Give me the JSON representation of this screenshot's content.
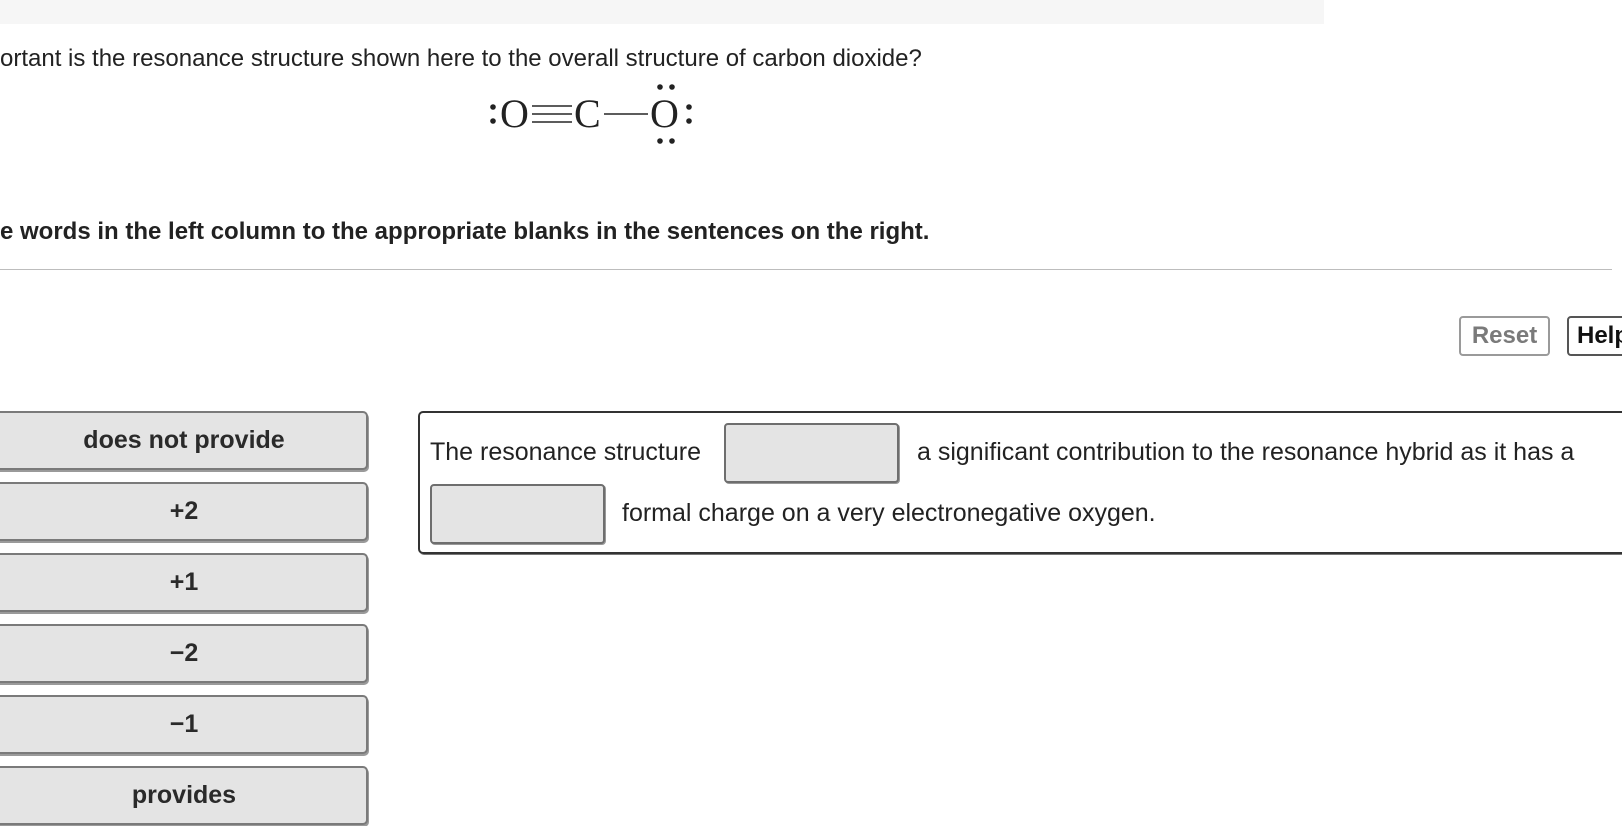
{
  "question": {
    "text": "ortant is the resonance structure shown here to the overall structure of carbon dioxide?"
  },
  "structure": {
    "left_atom": "O",
    "center_atom": "C",
    "right_atom": "O"
  },
  "instruction": {
    "text": "e words in the left column to the appropriate blanks in the sentences on the right."
  },
  "toolbar": {
    "reset_label": "Reset",
    "help_label": "Help"
  },
  "choices": [
    {
      "label": "does not provide"
    },
    {
      "label": "+2"
    },
    {
      "label": "+1"
    },
    {
      "label": "−2"
    },
    {
      "label": "−1"
    },
    {
      "label": "provides"
    }
  ],
  "sentence": {
    "part1": "The resonance structure",
    "part2": "a significant contribution to the resonance hybrid as it has a",
    "part3": "formal charge on a very electronegative oxygen."
  }
}
